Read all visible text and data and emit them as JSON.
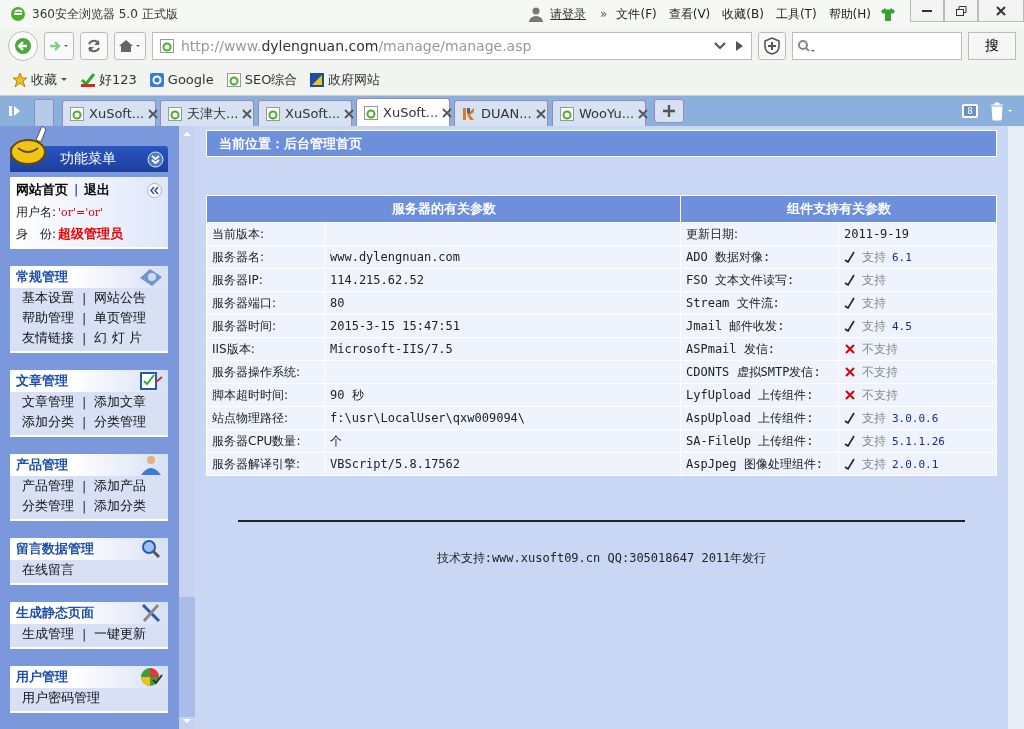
{
  "window": {
    "title": "360安全浏览器 5.0 正式版",
    "login": "请登录",
    "more": "»",
    "menu": [
      "文件(F)",
      "查看(V)",
      "收藏(B)",
      "工具(T)",
      "帮助(H)"
    ]
  },
  "address_bar": {
    "prefix": "http://www.",
    "domain": "dylengnuan.com",
    "path": "/manage/manage.asp"
  },
  "search": {
    "button": "搜"
  },
  "bookmarks": [
    {
      "label": "收藏",
      "kind": "star"
    },
    {
      "label": "好123",
      "kind": "hao"
    },
    {
      "label": "Google",
      "kind": "google"
    },
    {
      "label": "SEO综合",
      "kind": "ie"
    },
    {
      "label": "政府网站",
      "kind": "gov"
    }
  ],
  "tabs": [
    {
      "label": "XuSoft...",
      "kind": "ie",
      "selected": false
    },
    {
      "label": "天津大...",
      "kind": "ie",
      "selected": false
    },
    {
      "label": "XuSoft...",
      "kind": "ie",
      "selected": false
    },
    {
      "label": "XuSoft...",
      "kind": "ie",
      "selected": true
    },
    {
      "label": "DUAN...",
      "kind": "hk",
      "selected": false
    },
    {
      "label": "WooYu...",
      "kind": "ie",
      "selected": false
    }
  ],
  "tab_count": "8",
  "sidebar": {
    "title": "功能菜单",
    "home": "网站首页",
    "home_separator": "|",
    "logout": "退出",
    "user_label": "用户名:",
    "user_value": "'or'='or'",
    "role_label": "身　份:",
    "role_value": "超级管理员",
    "separator": "|",
    "groups": [
      {
        "title": "常规管理",
        "kind": "gear",
        "rows": [
          [
            "基本设置",
            "网站公告"
          ],
          [
            "帮助管理",
            "单页管理"
          ],
          [
            "友情链接",
            "幻 灯 片"
          ]
        ]
      },
      {
        "title": "文章管理",
        "kind": "edit",
        "rows": [
          [
            "文章管理",
            "添加文章"
          ],
          [
            "添加分类",
            "分类管理"
          ]
        ]
      },
      {
        "title": "产品管理",
        "kind": "person",
        "rows": [
          [
            "产品管理",
            "添加产品"
          ],
          [
            "分类管理",
            "添加分类"
          ]
        ]
      },
      {
        "title": "留言数据管理",
        "kind": "search",
        "rows": [
          [
            "在线留言"
          ]
        ]
      },
      {
        "title": "生成静态页面",
        "kind": "tools",
        "rows": [
          [
            "生成管理",
            "一键更新"
          ]
        ]
      },
      {
        "title": "用户管理",
        "kind": "ball",
        "rows": [
          [
            "用户密码管理"
          ]
        ]
      }
    ]
  },
  "breadcrumb": "当前位置：后台管理首页",
  "server": {
    "heading": "服务器的有关参数",
    "rows": [
      {
        "label": "当前版本:",
        "value": ""
      },
      {
        "label": "服务器名:",
        "value": "www.dylengnuan.com"
      },
      {
        "label": "服务器IP:",
        "value": "114.215.62.52"
      },
      {
        "label": "服务器端口:",
        "value": "80"
      },
      {
        "label": "服务器时间:",
        "value": "2015-3-15 15:47:51"
      },
      {
        "label": "IIS版本:",
        "value": "Microsoft-IIS/7.5"
      },
      {
        "label": "服务器操作系统:",
        "value": ""
      },
      {
        "label": "脚本超时时间:",
        "value": "90 秒"
      },
      {
        "label": "站点物理路径:",
        "value": "f:\\usr\\LocalUser\\qxw009094\\"
      },
      {
        "label": "服务器CPU数量:",
        "value": "个"
      },
      {
        "label": "服务器解译引擎:",
        "value": "VBScript/5.8.17562"
      }
    ]
  },
  "components": {
    "heading": "组件支持有关参数",
    "date_label": "更新日期:",
    "date_value": "2011-9-19",
    "rows": [
      {
        "label": "ADO 数据对像:",
        "supported": true,
        "status": "支持",
        "version": "6.1"
      },
      {
        "label": "FSO 文本文件读写:",
        "supported": true,
        "status": "支持"
      },
      {
        "label": "Stream 文件流:",
        "supported": true,
        "status": "支持"
      },
      {
        "label": "Jmail 邮件收发:",
        "supported": true,
        "status": "支持",
        "version": "4.5"
      },
      {
        "label": "ASPmail 发信:",
        "supported": false,
        "status": "不支持"
      },
      {
        "label": "CDONTS 虚拟SMTP发信:",
        "supported": false,
        "status": "不支持"
      },
      {
        "label": "LyfUpload 上传组件:",
        "supported": false,
        "status": "不支持"
      },
      {
        "label": "AspUpload 上传组件:",
        "supported": true,
        "status": "支持",
        "version": "3.0.0.6"
      },
      {
        "label": "SA-FileUp 上传组件:",
        "supported": true,
        "status": "支持",
        "version": "5.1.1.26"
      },
      {
        "label": "AspJpeg 图像处理组件:",
        "supported": true,
        "status": "支持",
        "version": "2.0.0.1"
      }
    ]
  },
  "footer": "技术支持:www.xusoft09.cn QQ:305018647 2011年发行"
}
